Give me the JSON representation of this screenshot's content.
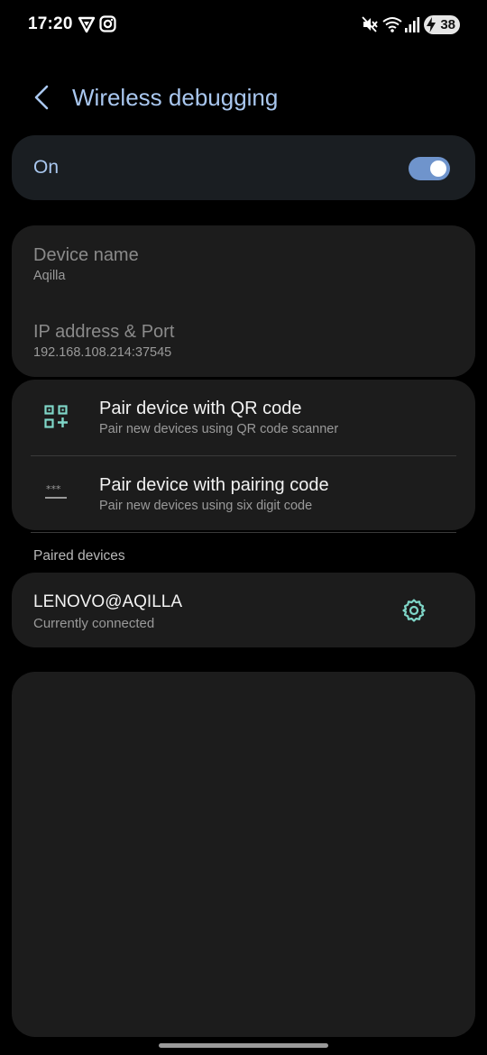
{
  "status_bar": {
    "time": "17:20",
    "battery_level": "38",
    "icons": [
      "vpn-shield-icon",
      "instagram-icon",
      "mute-icon",
      "wifi-icon",
      "signal-icon",
      "battery-charging-icon"
    ]
  },
  "header": {
    "title": "Wireless debugging",
    "back_icon": "chevron-left-icon"
  },
  "master_switch": {
    "label": "On",
    "checked": true
  },
  "device_info": {
    "device_name_label": "Device name",
    "device_name_value": "Aqilla",
    "ip_label": "IP address & Port",
    "ip_value": "192.168.108.214:37545"
  },
  "pairing": {
    "qr_title": "Pair device with QR code",
    "qr_sub": "Pair new devices using QR code scanner",
    "code_title": "Pair device with pairing code",
    "code_sub": "Pair new devices using six digit code"
  },
  "paired_devices": {
    "header": "Paired devices",
    "items": [
      {
        "name": "LENOVO@AQILLA",
        "status": "Currently connected"
      }
    ]
  },
  "colors": {
    "accent": "#a9c7ef",
    "toggle_on": "#6f94cc",
    "icon_teal": "#7fd6c8",
    "card_bg": "#1c1c1c"
  }
}
